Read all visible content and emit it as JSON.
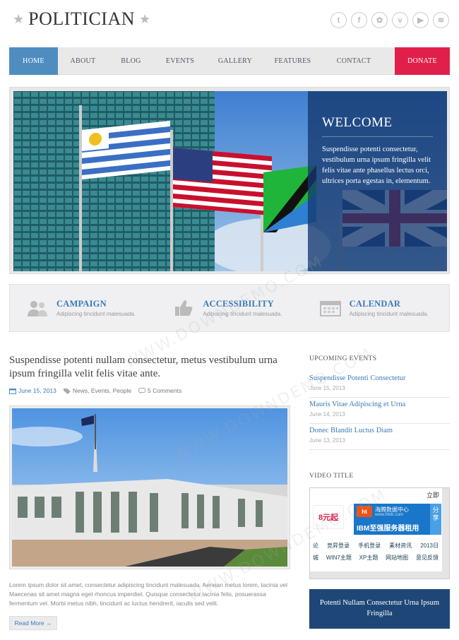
{
  "header": {
    "logo": "POLITICIAN",
    "star": "★",
    "social": [
      "twitter-icon",
      "facebook-icon",
      "dribbble-icon",
      "vimeo-icon",
      "youtube-icon",
      "rss-icon"
    ],
    "social_glyphs": [
      "t",
      "f",
      "✿",
      "v",
      "▶",
      "≋"
    ]
  },
  "nav": {
    "items": [
      "HOME",
      "ABOUT",
      "BLOG",
      "EVENTS",
      "GALLERY",
      "FEATURES",
      "CONTACT"
    ],
    "donate": "DONATE"
  },
  "hero": {
    "title": "WELCOME",
    "text": "Suspendisse potenti consectetur, vestibulum urna ipsum fringilla velit felis vitae ante phasellus lectus orci, ultrices porta egestas in, elementum."
  },
  "features": [
    {
      "title": "CAMPAIGN",
      "desc": "Adipiscing tincidunt malesuada.",
      "icon": "people-icon"
    },
    {
      "title": "ACCESSIBILITY",
      "desc": "Adipiscing tincidunt malesuada.",
      "icon": "thumbs-up-icon"
    },
    {
      "title": "CALENDAR",
      "desc": "Adipiscing tincidunt malesuada.",
      "icon": "calendar-icon"
    }
  ],
  "post": {
    "title": "Suspendisse potenti nullam consectetur, metus vestibulum urna ipsum fringilla velit felis vitae ante.",
    "date": "June 15, 2013",
    "tags": "News, Events, People",
    "comments": "5 Comments",
    "excerpt": "Lorem ipsum dolor sit amet, consectetur adipiscing tincidunt malesuada. Aenean metus lorem, lacinia vel Maecenas sit amet magna eget rhoncus imperdiet. Quisque consectetur lacinia felis, posuerassa fermentum vel. Morbi metus nibh, tincidunt ac luctus hendrerit, iaculis sed velit.",
    "read_more": "Read More →"
  },
  "sidebar": {
    "events_heading": "UPCOMING EVENTS",
    "events": [
      {
        "title": "Suspendisse Potenti Consectetur",
        "date": "June 15, 2013"
      },
      {
        "title": "Mauris Vitae Adipiscing et Urna",
        "date": "June 14, 2013"
      },
      {
        "title": "Donec Blandit Luctus Diam",
        "date": "June 13, 2013"
      }
    ],
    "video_heading": "VIDEO TITLE",
    "video": {
      "top_right": "立即",
      "badge": "8元起",
      "brand": "海腾数据中心",
      "brand_url": "www.htidc.com",
      "slogan": "IBM至强服务器租用",
      "side": "分享",
      "links_row1": [
        "论",
        "竞昇登录",
        "手机登录",
        "素材资讯",
        "2013日"
      ],
      "links_row2": [
        "城",
        "WIN7主题",
        "XP主题",
        "网站地图",
        "意见反馈"
      ]
    },
    "promo": "Potenti Nullam Consectetur Urna Ipsum Fringilla"
  },
  "watermark": "WWW.DOWNDEMO.COM",
  "colors": {
    "accent": "#4f8dc1",
    "donate": "#e0204a",
    "link": "#3a7ab5",
    "navy": "#1e4778"
  }
}
